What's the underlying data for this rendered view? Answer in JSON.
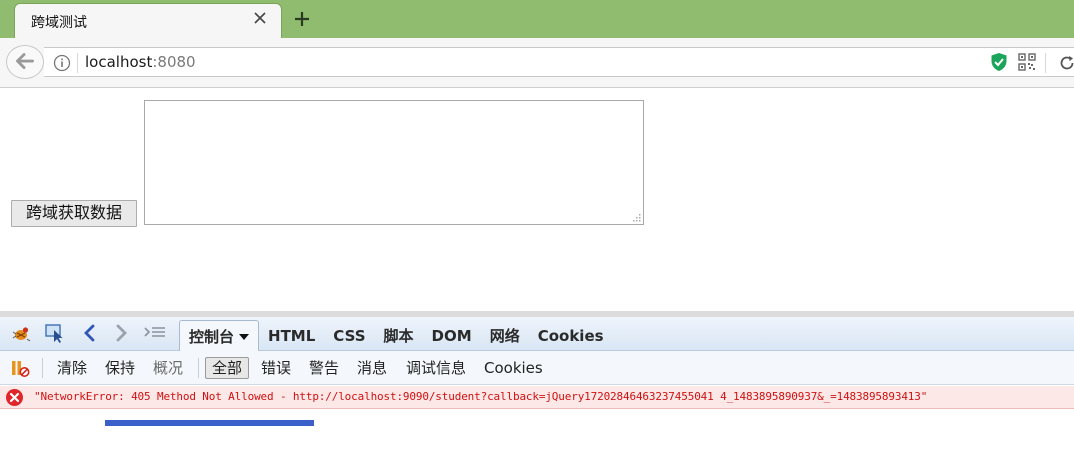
{
  "browser": {
    "tab_title": "跨域测试",
    "url_host": "localhost",
    "url_port": ":8080"
  },
  "page": {
    "fetch_button_label": "跨域获取数据",
    "result_text": ""
  },
  "firebug": {
    "tabs": [
      {
        "label": "控制台",
        "active": true
      },
      {
        "label": "HTML"
      },
      {
        "label": "CSS"
      },
      {
        "label": "脚本"
      },
      {
        "label": "DOM"
      },
      {
        "label": "网络"
      },
      {
        "label": "Cookies"
      }
    ],
    "console_toolbar": {
      "clear": "清除",
      "persist": "保持",
      "profile": "概况",
      "filter_all": "全部",
      "filter_errors": "错误",
      "filter_warnings": "警告",
      "filter_info": "消息",
      "filter_debug": "调试信息",
      "filter_cookies": "Cookies"
    },
    "console_messages": [
      {
        "level": "error",
        "text": "\"NetworkError: 405 Method Not Allowed - http://localhost:9090/student?callback=jQuery17202846463237455041 4_1483895890937&_=1483895893413\""
      }
    ]
  },
  "colors": {
    "tabstrip": "#8fbc6e",
    "error_text": "#d01111",
    "error_bg": "#fde8e8",
    "accent_blue": "#3a5fc8"
  }
}
